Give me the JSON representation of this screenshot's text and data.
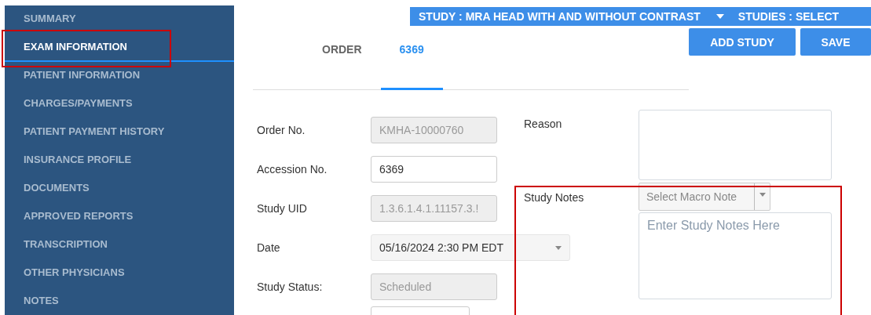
{
  "sidebar": {
    "items": [
      {
        "label": "SUMMARY",
        "selected": false
      },
      {
        "label": "EXAM INFORMATION",
        "selected": true
      },
      {
        "label": "PATIENT INFORMATION",
        "selected": false
      },
      {
        "label": "CHARGES/PAYMENTS",
        "selected": false
      },
      {
        "label": "PATIENT PAYMENT HISTORY",
        "selected": false
      },
      {
        "label": "INSURANCE PROFILE",
        "selected": false
      },
      {
        "label": "DOCUMENTS",
        "selected": false
      },
      {
        "label": "APPROVED REPORTS",
        "selected": false
      },
      {
        "label": "TRANSCRIPTION",
        "selected": false
      },
      {
        "label": "OTHER PHYSICIANS",
        "selected": false
      },
      {
        "label": "NOTES",
        "selected": false
      }
    ]
  },
  "header": {
    "study": "STUDY : MRA HEAD WITH AND WITHOUT CONTRAST",
    "studies": "STUDIES : SELECT"
  },
  "buttons": [
    "ADD STUDY",
    "SAVE"
  ],
  "tabs": [
    {
      "label": "ORDER",
      "selected": false
    },
    {
      "label": "6369",
      "selected": true
    }
  ],
  "fields": [
    {
      "label": "Order No.",
      "kind": "input",
      "value": "KMHA-10000760",
      "disabled": true
    },
    {
      "label": "Accession No.",
      "kind": "input",
      "value": "6369",
      "disabled": false
    },
    {
      "label": "Study UID",
      "kind": "input",
      "value": "1.3.6.1.4.1.11157.3.!",
      "disabled": true
    },
    {
      "label": "Date",
      "kind": "select",
      "value": "05/16/2024 2:30 PM EDT",
      "disabled": false
    },
    {
      "label": "Study Status:",
      "kind": "input",
      "value": "Scheduled",
      "disabled": true
    }
  ],
  "reason": {
    "label": "Reason"
  },
  "study_notes": {
    "label": "Study Notes",
    "macro_placeholder": "Select Macro Note",
    "placeholder": "Enter Study Notes Here"
  }
}
